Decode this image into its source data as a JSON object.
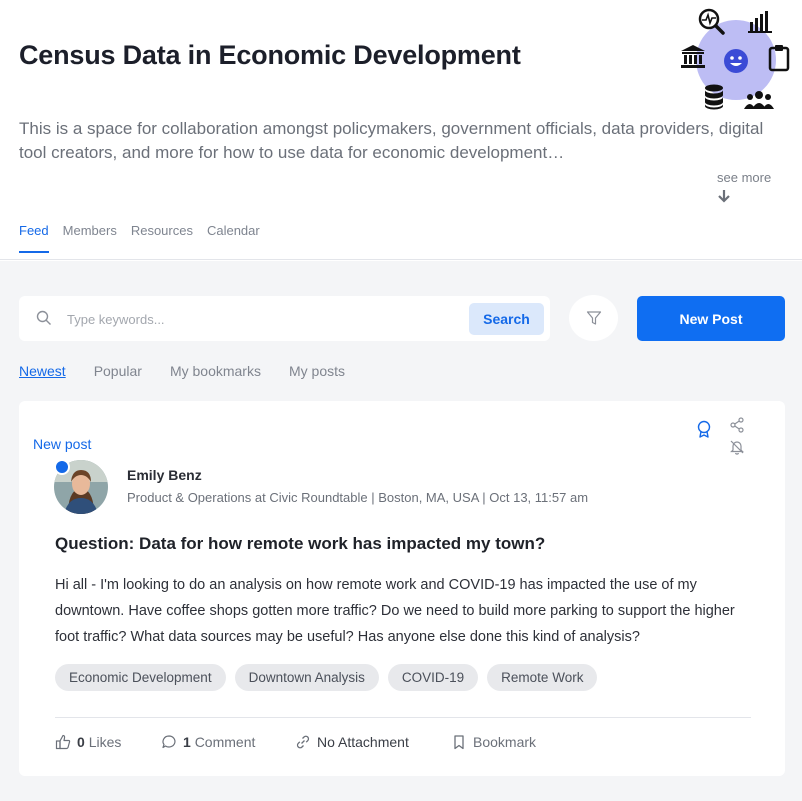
{
  "header": {
    "title": "Census Data in Economic Development",
    "description": "This is a space for collaboration amongst policymakers, government officials, data providers, digital tool creators, and more for how to use data for economic development…",
    "see_more": "see more"
  },
  "tabs": [
    {
      "label": "Feed",
      "active": true
    },
    {
      "label": "Members",
      "active": false
    },
    {
      "label": "Resources",
      "active": false
    },
    {
      "label": "Calendar",
      "active": false
    }
  ],
  "search": {
    "placeholder": "Type keywords...",
    "value": "",
    "button_label": "Search"
  },
  "new_post_label": "New Post",
  "sort_tabs": [
    {
      "label": "Newest",
      "active": true
    },
    {
      "label": "Popular",
      "active": false
    },
    {
      "label": "My bookmarks",
      "active": false
    },
    {
      "label": "My posts",
      "active": false
    }
  ],
  "post": {
    "badge": "New post",
    "author": "Emily Benz",
    "meta": "Product & Operations at Civic Roundtable | Boston, MA, USA | Oct 13, 11:57 am",
    "title": "Question: Data for how remote work has impacted my town?",
    "body": "Hi all - I'm looking to do an analysis on how remote work and COVID-19 has impacted the use of my downtown. Have coffee shops gotten more traffic? Do we need to build more parking to support the higher foot traffic? What data sources may be useful? Has anyone else done this kind of analysis?",
    "tags": [
      "Economic Development",
      "Downtown Analysis",
      "COVID-19",
      "Remote Work"
    ],
    "likes_count": "0",
    "likes_label": "Likes",
    "comments_count": "1",
    "comments_label": "Comment",
    "attachment_label": "No Attachment",
    "bookmark_label": "Bookmark"
  },
  "colors": {
    "accent": "#1469e8",
    "primary_button": "#0f6ef2",
    "hero_circle": "#bdbdf4",
    "page_bg": "#f4f5f7"
  },
  "icons": [
    "heartbeat-magnifier-icon",
    "bar-chart-icon",
    "bank-icon",
    "smiley-icon",
    "clipboard-icon",
    "database-icon",
    "people-icon",
    "search-icon",
    "filter-icon",
    "award-icon",
    "share-icon",
    "bell-off-icon",
    "thumbs-up-icon",
    "comment-icon",
    "link-icon",
    "bookmark-icon",
    "arrow-down-icon"
  ]
}
